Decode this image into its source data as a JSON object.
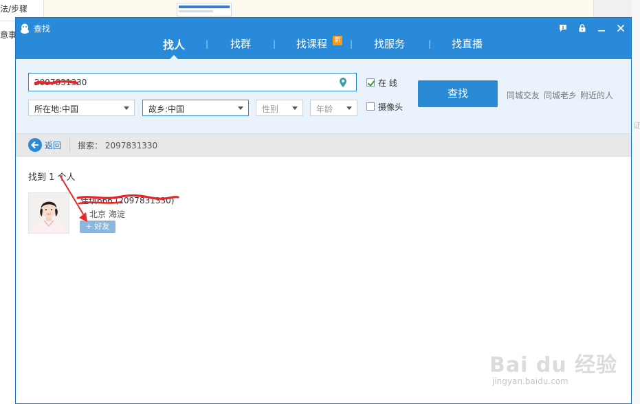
{
  "background": {
    "left_text_1": "法/步骤",
    "left_text_2": "意事",
    "right_text": "证"
  },
  "window": {
    "title": "查找",
    "buttons": [
      "feedback-icon",
      "lock-icon",
      "minimize-icon",
      "close-icon"
    ]
  },
  "tabs": [
    {
      "label": "找人",
      "active": true
    },
    {
      "label": "找群",
      "active": false
    },
    {
      "label": "找课程",
      "active": false,
      "badge": "新"
    },
    {
      "label": "找服务",
      "active": false
    },
    {
      "label": "找直播",
      "active": false
    }
  ],
  "search": {
    "keyword_value": "2097831330",
    "location_filter": "所在地:中国",
    "hometown_filter": "故乡:中国",
    "gender_placeholder": "性别",
    "age_placeholder": "年龄",
    "online_label": "在  线",
    "online_checked": true,
    "camera_label": "摄像头",
    "camera_checked": false,
    "find_button": "查找",
    "quick_links": [
      "同城交友",
      "同城老乡",
      "附近的人"
    ]
  },
  "breadcrumb": {
    "back_label": "返回",
    "search_label": "搜索：",
    "search_value": "2097831330"
  },
  "results": {
    "found_text": "找到 1 个人",
    "items": [
      {
        "name": "佳琪666 (2097831330)",
        "location": "北京 海淀",
        "add_button": "+ 好友"
      }
    ]
  },
  "watermark": {
    "brand": "Bai du 经验",
    "url": "jingyan.baidu.com"
  },
  "colors": {
    "titlebar": "#288ad8",
    "accent": "#2b8ad5",
    "panel": "#eaf3fb",
    "badge": "#f39a1b",
    "annotation": "#e8262a"
  }
}
